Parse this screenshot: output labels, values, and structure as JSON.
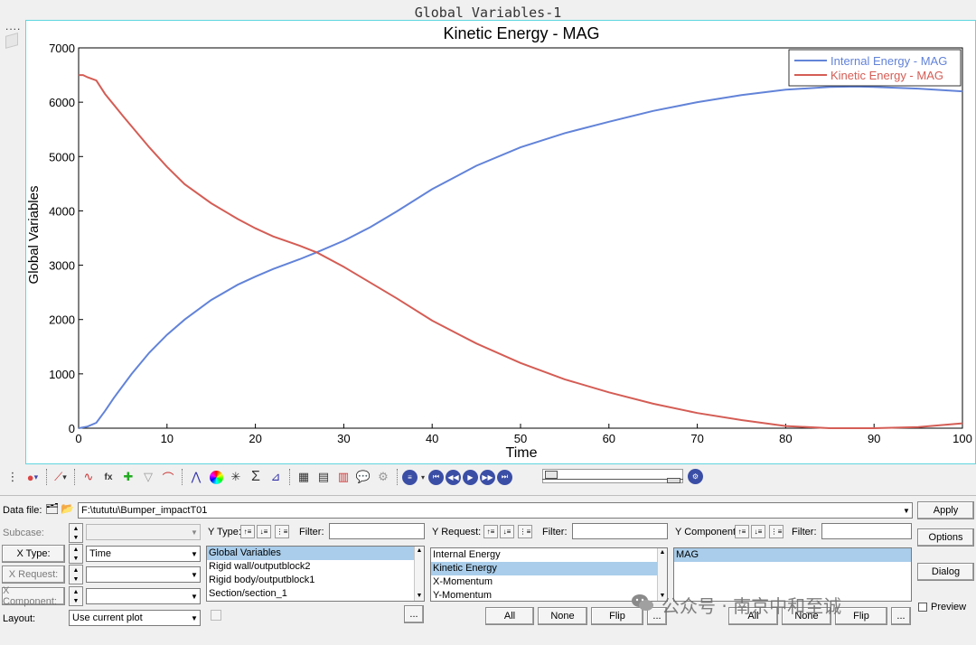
{
  "window_title": "Global Variables-1",
  "dots": "....",
  "chart_data": {
    "type": "line",
    "title": "Kinetic Energy - MAG",
    "xlabel": "Time",
    "ylabel": "Global Variables",
    "xlim": [
      0,
      100
    ],
    "ylim": [
      0,
      7000
    ],
    "xticks": [
      0,
      10,
      20,
      30,
      40,
      50,
      60,
      70,
      80,
      90,
      100
    ],
    "yticks": [
      0,
      1000,
      2000,
      3000,
      4000,
      5000,
      6000,
      7000
    ],
    "grid": true,
    "legend": "top-right",
    "series": [
      {
        "name": "Internal Energy - MAG",
        "color": "#6283d8",
        "x": [
          0,
          1,
          2,
          3,
          4,
          6,
          8,
          10,
          12,
          15,
          18,
          20,
          22,
          25,
          27,
          30,
          33,
          36,
          40,
          45,
          50,
          55,
          60,
          65,
          70,
          75,
          80,
          85,
          88,
          90,
          95,
          100
        ],
        "y": [
          0,
          30,
          100,
          320,
          560,
          1000,
          1390,
          1720,
          2000,
          2360,
          2640,
          2790,
          2930,
          3110,
          3240,
          3450,
          3700,
          3990,
          4400,
          4830,
          5170,
          5430,
          5640,
          5840,
          6000,
          6130,
          6230,
          6280,
          6290,
          6280,
          6250,
          6200
        ]
      },
      {
        "name": "Kinetic Energy - MAG",
        "color": "#d45d55",
        "x": [
          0,
          0.5,
          1,
          2,
          3,
          5,
          8,
          10,
          12,
          15,
          18,
          20,
          22,
          25,
          27,
          30,
          33,
          36,
          40,
          45,
          50,
          55,
          60,
          65,
          70,
          75,
          80,
          85,
          88,
          90,
          95,
          100
        ],
        "y": [
          6500,
          6500,
          6460,
          6400,
          6150,
          5750,
          5170,
          4810,
          4490,
          4140,
          3850,
          3680,
          3530,
          3360,
          3230,
          2970,
          2680,
          2390,
          1980,
          1560,
          1200,
          900,
          660,
          450,
          280,
          150,
          40,
          0,
          0,
          0,
          20,
          90
        ]
      }
    ]
  },
  "panel": {
    "data_file_label": "Data file:",
    "data_file_value": "F:\\tututu\\Bumper_impactT01",
    "apply": "Apply",
    "options": "Options",
    "dialog": "Dialog",
    "preview": "Preview",
    "subcase_label": "Subcase:",
    "xtype_label": "X Type:",
    "xtype_value": "Time",
    "xrequest_label": "X Request:",
    "xcomponent_label": "X Component:",
    "layout_label": "Layout:",
    "layout_value": "Use current plot",
    "ytype_label": "Y Type:",
    "yrequest_label": "Y Request:",
    "ycomponent_label": "Y Component:",
    "filter_label": "Filter:",
    "ytype_items": [
      "Global Variables",
      "Rigid wall/outputblock2",
      "Rigid body/outputblock1",
      "Section/section_1"
    ],
    "yrequest_items": [
      "Internal Energy",
      "Kinetic Energy",
      "X-Momentum",
      "Y-Momentum"
    ],
    "ycomponent_items": [
      "MAG"
    ],
    "all": "All",
    "none": "None",
    "flip": "Flip",
    "more": "...",
    "watermark": "公众号 · 南京中和至诚"
  }
}
